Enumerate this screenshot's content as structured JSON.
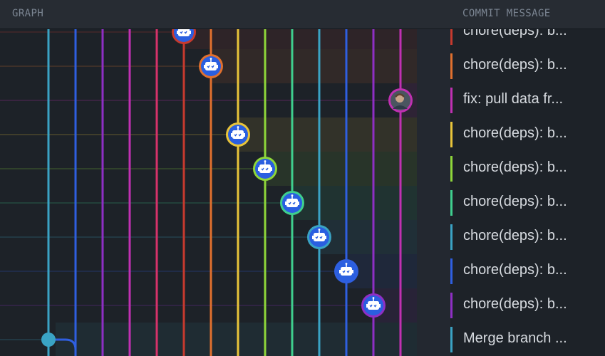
{
  "header": {
    "graph_label": "GRAPH",
    "message_label": "COMMIT MESSAGE"
  },
  "lanes": [
    {
      "color": "#3aa3c4"
    },
    {
      "color": "#2f5fe0"
    },
    {
      "color": "#8e2fc4"
    },
    {
      "color": "#c030b2"
    },
    {
      "color": "#d6326a"
    },
    {
      "color": "#c63a2e"
    },
    {
      "color": "#e0702e"
    },
    {
      "color": "#e8c43a"
    },
    {
      "color": "#8ed63a"
    },
    {
      "color": "#3fcf8e"
    },
    {
      "color": "#3aa3c4"
    },
    {
      "color": "#2f5fe0"
    },
    {
      "color": "#8e2fc4"
    },
    {
      "color": "#c030b2"
    }
  ],
  "commits": [
    {
      "message": "chore(deps): b...",
      "lane": 5,
      "avatar": "bot-avatar-icon",
      "color": "#c63a2e"
    },
    {
      "message": "chore(deps): b...",
      "lane": 6,
      "avatar": "bot-avatar-icon",
      "color": "#e0702e"
    },
    {
      "message": "fix: pull data fr...",
      "lane": 13,
      "avatar": "user-avatar-icon",
      "color": "#c030b2"
    },
    {
      "message": "chore(deps): b...",
      "lane": 7,
      "avatar": "bot-avatar-icon",
      "color": "#e8c43a"
    },
    {
      "message": "chore(deps): b...",
      "lane": 8,
      "avatar": "bot-avatar-icon",
      "color": "#8ed63a"
    },
    {
      "message": "chore(deps): b...",
      "lane": 9,
      "avatar": "bot-avatar-icon",
      "color": "#3fcf8e"
    },
    {
      "message": "chore(deps): b...",
      "lane": 10,
      "avatar": "bot-avatar-icon",
      "color": "#3aa3c4"
    },
    {
      "message": "chore(deps): b...",
      "lane": 11,
      "avatar": "bot-avatar-icon",
      "color": "#2f5fe0"
    },
    {
      "message": "chore(deps): b...",
      "lane": 12,
      "avatar": "bot-avatar-icon",
      "color": "#8e2fc4"
    },
    {
      "message": "Merge branch ...",
      "lane": 0,
      "avatar": "merge-dot",
      "color": "#3aa3c4"
    }
  ]
}
